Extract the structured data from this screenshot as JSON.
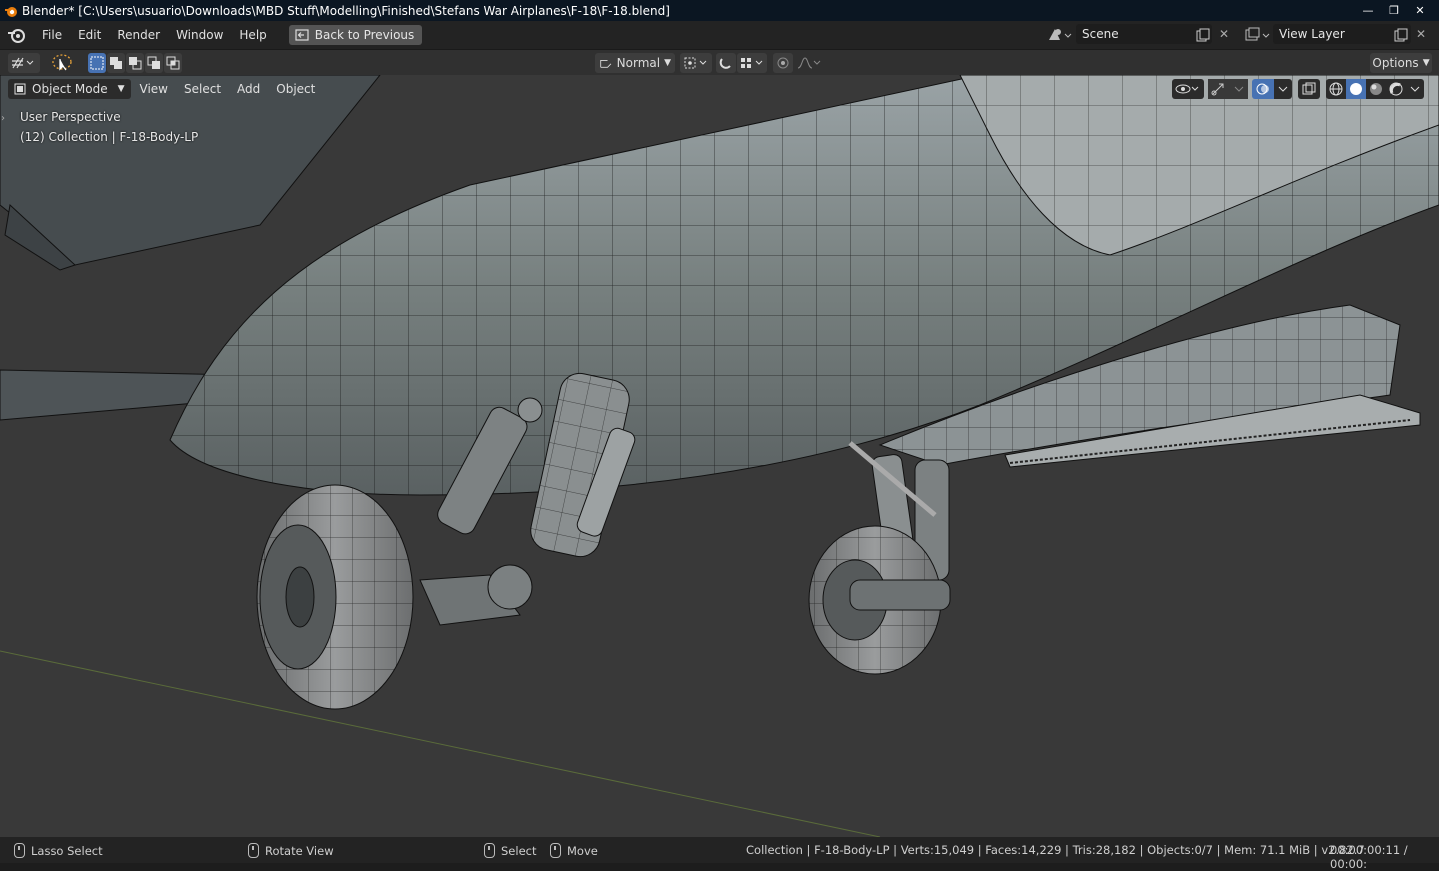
{
  "window": {
    "title": "Blender* [C:\\Users\\usuario\\Downloads\\MBD Stuff\\Modelling\\Finished\\Stefans War Airplanes\\F-18\\F-18.blend]",
    "icons": [
      "minimize-icon",
      "maximize-icon",
      "close-icon"
    ]
  },
  "menubar": {
    "items": [
      "File",
      "Edit",
      "Render",
      "Window",
      "Help"
    ],
    "back_button": "Back to Previous",
    "scene": "Scene",
    "view_layer": "View Layer"
  },
  "toolbar": {
    "transform_orientation": "Normal",
    "options_label": "Options"
  },
  "viewport": {
    "mode": "Object Mode",
    "menus": [
      "View",
      "Select",
      "Add",
      "Object"
    ],
    "perspective_label": "User Perspective",
    "collection_label": "(12) Collection | F-18-Body-LP"
  },
  "statusbar": {
    "lasso": "Lasso Select",
    "rotate": "Rotate View",
    "select": "Select",
    "move": "Move",
    "stats": "Collection | F-18-Body-LP | Verts:15,049 | Faces:14,229 | Tris:28,182 | Objects:0/7 | Mem: 71.1 MiB | v2.82.7",
    "time": "00:00:00:11 / 00:00:"
  },
  "colors": {
    "accent": "#4772b3",
    "viewport_bg": "#393939",
    "header_bg": "#232323"
  }
}
